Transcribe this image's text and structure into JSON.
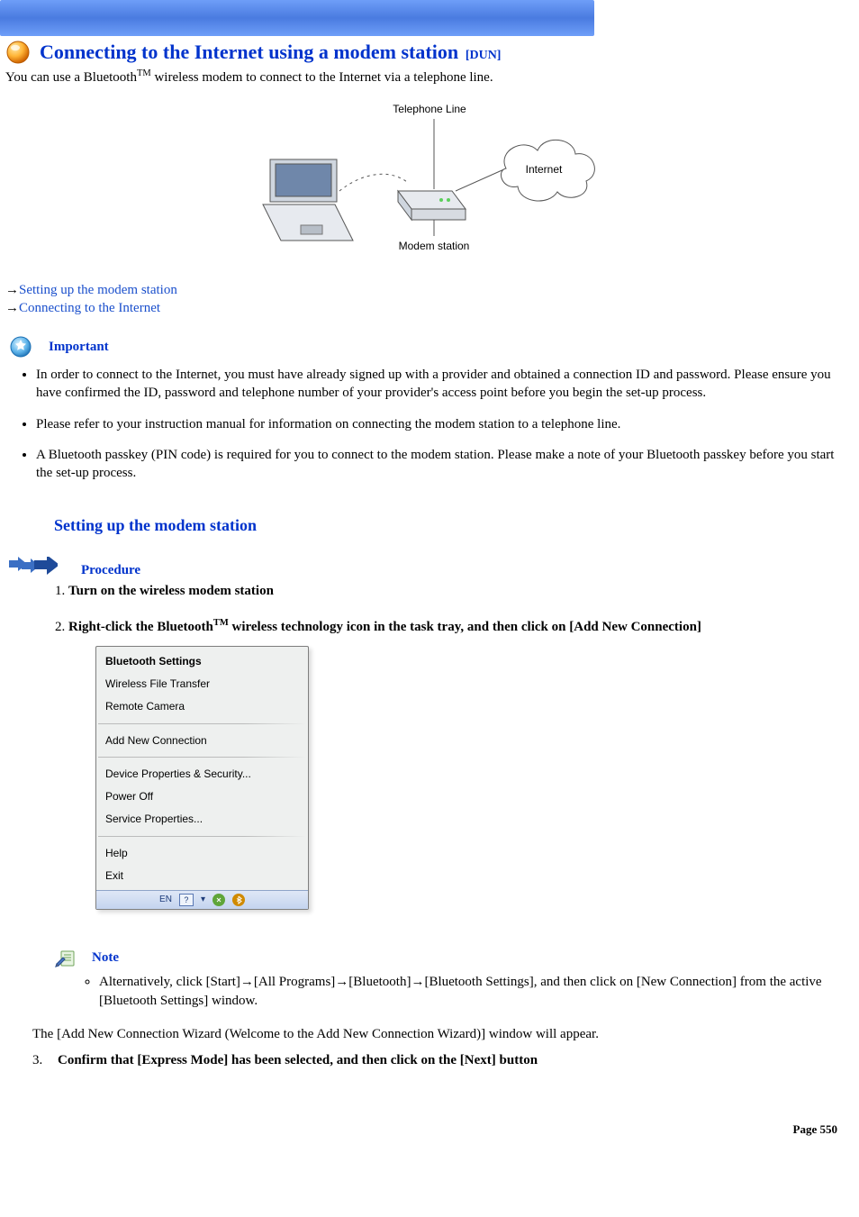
{
  "header": {
    "title": "Connecting to the Internet using a modem station",
    "tag": "[DUN]"
  },
  "intro_prefix": "You can use a Bluetooth",
  "tm": "TM",
  "intro_suffix": " wireless modem to connect to the Internet via a telephone line.",
  "diagram": {
    "telephone_line": "Telephone Line",
    "internet": "Internet",
    "modem_station": "Modem station"
  },
  "arrow_glyph": "→",
  "links": {
    "setup": "Setting up the modem station",
    "connect": "Connecting to the Internet"
  },
  "important_label": "Important",
  "important_items": [
    "In order to connect to the Internet, you must have already signed up with a provider and obtained a connection ID and password. Please ensure you have confirmed the ID, password and telephone number of your provider's access point before you begin the set-up process.",
    "Please refer to your instruction manual for information on connecting the modem station to a telephone line.",
    "A Bluetooth passkey (PIN code) is required for you to connect to the modem station. Please make a note of your Bluetooth passkey before you start the set-up process."
  ],
  "subheading": "Setting up the modem station",
  "procedure_label": "Procedure",
  "steps": {
    "s1": "Turn on the wireless modem station",
    "s2_prefix": "Right-click the Bluetooth",
    "s2_suffix": " wireless technology icon in the task tray, and then click on [Add New Connection]"
  },
  "menu": {
    "bluetooth_settings": "Bluetooth Settings",
    "wireless_file_transfer": "Wireless File Transfer",
    "remote_camera": "Remote Camera",
    "add_new_connection": "Add New Connection",
    "device_props": "Device Properties & Security...",
    "power_off": "Power Off",
    "service_props": "Service Properties...",
    "help": "Help",
    "exit": "Exit",
    "lang": "EN",
    "question": "?"
  },
  "note_label": "Note",
  "note_item": "Alternatively, click [Start]→[All Programs]→[Bluetooth]→[Bluetooth Settings], and then click on [New Connection] from the active [Bluetooth Settings] window.",
  "wizard_para": "The [Add New Connection Wizard (Welcome to the Add New Connection Wizard)] window will appear.",
  "step3_num": "3.",
  "step3_text": "Confirm that [Express Mode] has been selected, and then click on the [Next] button",
  "footer": {
    "page_label": "Page",
    "page_number": "550"
  }
}
